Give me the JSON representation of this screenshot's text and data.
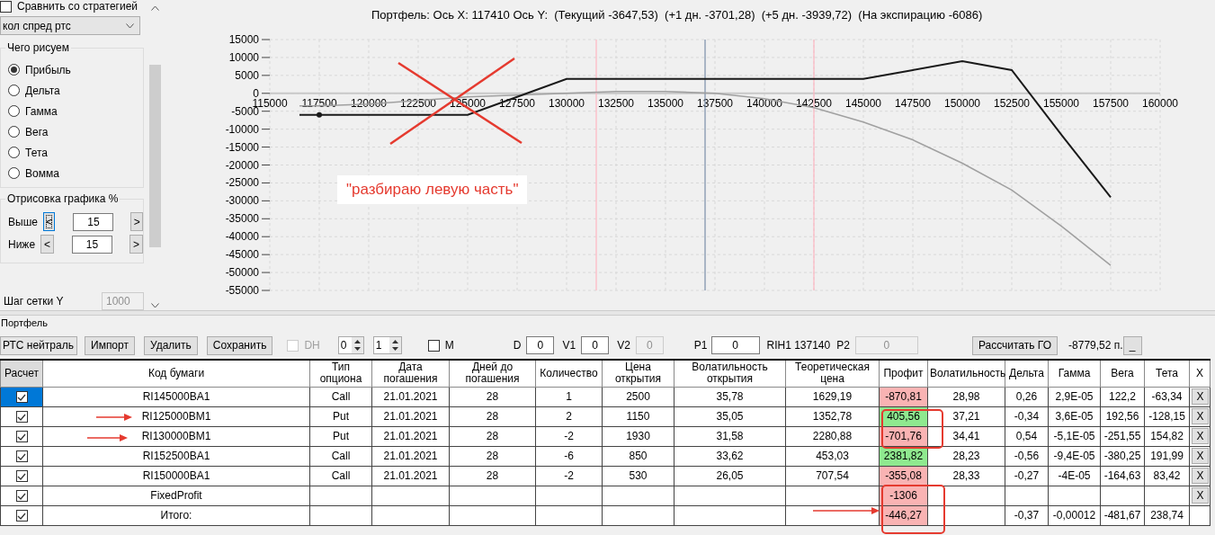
{
  "options_panel": {
    "compare_checkbox": {
      "label": "Сравнить со стратегией",
      "checked": false
    },
    "strategy_select": "кол спред ртс",
    "draw_group": {
      "title": "Чего рисуем",
      "options": [
        {
          "label": "Прибыль",
          "selected": true
        },
        {
          "label": "Дельта",
          "selected": false
        },
        {
          "label": "Гамма",
          "selected": false
        },
        {
          "label": "Вега",
          "selected": false
        },
        {
          "label": "Тета",
          "selected": false
        },
        {
          "label": "Вомма",
          "selected": false
        }
      ]
    },
    "range_group": {
      "title": "Отрисовка графика %",
      "rows": [
        {
          "label": "Выше",
          "dec": "<",
          "value": "15",
          "inc": ">",
          "focused": true
        },
        {
          "label": "Ниже",
          "dec": "<",
          "value": "15",
          "inc": ">",
          "focused": false
        }
      ]
    },
    "grid_step": {
      "label": "Шаг сетки Y",
      "value": "1000",
      "disabled": true
    }
  },
  "chart": {
    "title": "Портфель: Ось X: 117410 Ось Y:  (Текущий -3647,53)  (+1 дн. -3701,28)  (+5 дн. -3939,72)  (На экспирацию -6086)",
    "chart_data": {
      "type": "line",
      "x": [
        116500,
        117500,
        120000,
        122500,
        125000,
        127500,
        130000,
        132500,
        135000,
        137500,
        140000,
        142500,
        145000,
        147500,
        150000,
        152500,
        155000,
        157500
      ],
      "series": [
        {
          "color": "#a0a0a0",
          "values": [
            -3500,
            -3500,
            -3000,
            -2000,
            -1000,
            -500,
            0,
            500,
            500,
            0,
            -1500,
            -4000,
            -8000,
            -13000,
            -19500,
            -27000,
            -37000,
            -48000
          ]
        },
        {
          "color": "#1a1a1a",
          "values": [
            -6000,
            -6000,
            -6000,
            -6000,
            -6000,
            -1000,
            4000,
            4000,
            4000,
            4000,
            4000,
            4000,
            4000,
            6500,
            9000,
            6500,
            -11500,
            -29000
          ]
        }
      ],
      "grid": true,
      "xlim": [
        115000,
        160000
      ],
      "ylim": [
        -55000,
        15000
      ],
      "xticks": [
        115000,
        117500,
        120000,
        122500,
        125000,
        127500,
        130000,
        132500,
        135000,
        137500,
        140000,
        142500,
        145000,
        147500,
        150000,
        152500,
        155000,
        157500,
        160000
      ],
      "yticks": [
        15000,
        10000,
        5000,
        0,
        -5000,
        -10000,
        -15000,
        -20000,
        -25000,
        -30000,
        -35000,
        -40000,
        -45000,
        -50000,
        -55000
      ],
      "ref_lines": [
        {
          "axis": "x",
          "value": 131500,
          "color": "#ffb6c1"
        },
        {
          "axis": "x",
          "value": 137000,
          "color": "#7a8ea8"
        },
        {
          "axis": "x",
          "value": 142500,
          "color": "#ffb6c1"
        }
      ]
    }
  },
  "note": "\"разбираю левую часть\"",
  "portfolio": {
    "title": "Портфель",
    "toolbar": {
      "preset_select": "РТС нейтраль",
      "buttons": [
        "Импорт",
        "Удалить",
        "Сохранить"
      ],
      "dh": {
        "label": "DH",
        "checked": false,
        "disabled": true
      },
      "spinners": [
        "0",
        "1"
      ],
      "m": {
        "label": "M",
        "checked": false
      },
      "fields": [
        {
          "label": "D",
          "value": "0",
          "disabled": false
        },
        {
          "label": "V1",
          "value": "0",
          "disabled": false
        },
        {
          "label": "V2",
          "value": "0",
          "disabled": true
        },
        {
          "label": "P1",
          "value": "0",
          "disabled": false
        }
      ],
      "instrument": "RIH1 137140",
      "p2": {
        "label": "P2",
        "value": "0",
        "disabled": true
      },
      "calc_button": "Рассчитать ГО",
      "margin": "-8779,52 п.",
      "minimize_button": "_"
    },
    "table": {
      "check_header": "Расчет",
      "columns": [
        "Код бумаги",
        "Тип опциона",
        "Дата погашения",
        "Дней до погашения",
        "Количество",
        "Цена открытия",
        "Волатильность открытия",
        "Теоретическая цена",
        "Профит",
        "Волатильность",
        "Дельта",
        "Гамма",
        "Вега",
        "Тета"
      ],
      "remove_header": "X",
      "rows": [
        {
          "checked": true,
          "selected": true,
          "color": "#f9b3b3",
          "cells": [
            "RI145000BA1",
            "Call",
            "21.01.2021",
            "28",
            "1",
            "2500",
            "35,78",
            "1629,19",
            "-870,81",
            "28,98",
            "0,26",
            "2,9E-05",
            "122,2",
            "-63,34"
          ],
          "remove": "X"
        },
        {
          "checked": true,
          "selected": false,
          "color": "#8fe98f",
          "cells": [
            "RI125000BM1",
            "Put",
            "21.01.2021",
            "28",
            "2",
            "1150",
            "35,05",
            "1352,78",
            "405,56",
            "37,21",
            "-0,34",
            "3,6E-05",
            "192,56",
            "-128,15"
          ],
          "remove": "X"
        },
        {
          "checked": true,
          "selected": false,
          "color": "#f9b3b3",
          "cells": [
            "RI130000BM1",
            "Put",
            "21.01.2021",
            "28",
            "-2",
            "1930",
            "31,58",
            "2280,88",
            "-701,76",
            "34,41",
            "0,54",
            "-5,1E-05",
            "-251,55",
            "154,82"
          ],
          "remove": "X"
        },
        {
          "checked": true,
          "selected": false,
          "color": "#8fe98f",
          "cells": [
            "RI152500BA1",
            "Call",
            "21.01.2021",
            "28",
            "-6",
            "850",
            "33,62",
            "453,03",
            "2381,82",
            "28,23",
            "-0,56",
            "-9,4E-05",
            "-380,25",
            "191,99"
          ],
          "remove": "X"
        },
        {
          "checked": true,
          "selected": false,
          "color": "#f9b3b3",
          "cells": [
            "RI150000BA1",
            "Call",
            "21.01.2021",
            "28",
            "-2",
            "530",
            "26,05",
            "707,54",
            "-355,08",
            "28,33",
            "-0,27",
            "-4E-05",
            "-164,63",
            "83,42"
          ],
          "remove": "X"
        },
        {
          "checked": true,
          "selected": false,
          "color": "#f9b3b3",
          "cells": [
            "FixedProfit",
            null,
            null,
            null,
            null,
            null,
            null,
            null,
            "-1306",
            null,
            null,
            null,
            null,
            null
          ],
          "remove": "X"
        },
        {
          "checked": true,
          "selected": false,
          "color": "#f9b3b3",
          "cells": [
            "Итого:",
            null,
            null,
            null,
            null,
            null,
            null,
            null,
            "-446,27",
            null,
            "-0,37",
            "-0,00012",
            "-481,67",
            "238,74"
          ]
        }
      ]
    }
  }
}
